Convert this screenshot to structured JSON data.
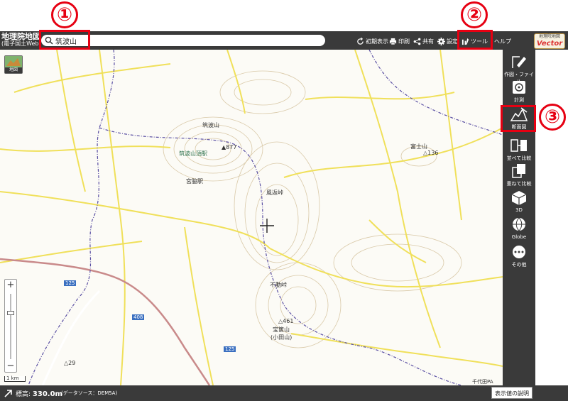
{
  "header": {
    "logo_line1": "地理院地図",
    "logo_line2": "(電子国土Web)",
    "search_value": "筑波山",
    "buttons": [
      {
        "label": "初期表示",
        "icon": "refresh-icon"
      },
      {
        "label": "印刷",
        "icon": "print-icon"
      },
      {
        "label": "共有",
        "icon": "share-icon"
      },
      {
        "label": "設定",
        "icon": "gear-icon"
      },
      {
        "label": "ツール",
        "icon": "tool-icon"
      },
      {
        "label": "ヘルプ",
        "icon": "help-icon"
      }
    ],
    "vector_small": "地理院地図",
    "vector_big": "Vector"
  },
  "map": {
    "layer_button_label": "地図",
    "scale_label": "1 km",
    "zoom_in": "+",
    "zoom_out": "−",
    "labels": [
      {
        "text": "筑波山",
        "cls": ""
      },
      {
        "text": "▲877",
        "cls": ""
      },
      {
        "text": "筑波山頂駅",
        "cls": "green"
      },
      {
        "text": "宮脇駅",
        "cls": ""
      },
      {
        "text": "風返峠",
        "cls": ""
      },
      {
        "text": "富士山",
        "cls": ""
      },
      {
        "text": "△136",
        "cls": ""
      },
      {
        "text": "不動峠",
        "cls": ""
      },
      {
        "text": "宝篋山",
        "cls": ""
      },
      {
        "text": "(小田山)",
        "cls": ""
      },
      {
        "text": "△461",
        "cls": ""
      },
      {
        "text": "125",
        "cls": ""
      },
      {
        "text": "125",
        "cls": ""
      },
      {
        "text": "408",
        "cls": ""
      },
      {
        "text": "△29",
        "cls": ""
      },
      {
        "text": "千代田PA",
        "cls": ""
      }
    ]
  },
  "side_panel": [
    {
      "label": "作図・ファイル",
      "icon": "pencil-icon"
    },
    {
      "label": "計測",
      "icon": "measure-icon"
    },
    {
      "label": "断面図",
      "icon": "profile-icon"
    },
    {
      "label": "並べて比較",
      "icon": "side-by-side-icon"
    },
    {
      "label": "重ねて比較",
      "icon": "overlay-icon"
    },
    {
      "label": "3D",
      "icon": "cube-icon"
    },
    {
      "label": "Globe",
      "icon": "globe-icon"
    },
    {
      "label": "その他",
      "icon": "more-icon"
    }
  ],
  "footer": {
    "elevation_prefix": "標高:",
    "elevation_value": "330.0m",
    "source": "(データソース：DEM5A)",
    "explain_button": "表示値の説明"
  },
  "annotations": {
    "n1": "①",
    "n2": "②",
    "n3": "③",
    "color": "#e60012"
  }
}
